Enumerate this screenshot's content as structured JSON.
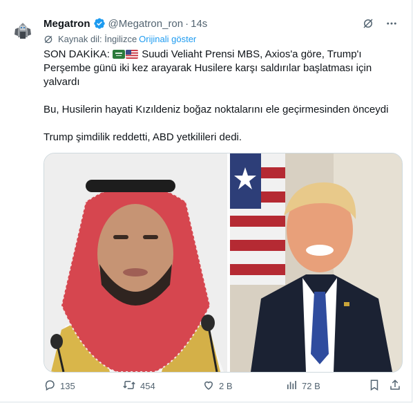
{
  "tweet": {
    "author_name": "Megatron",
    "handle": "@Megatron_ron",
    "separator": "·",
    "time": "14s",
    "source_label": "Kaynak dil: İngilizce",
    "show_original": "Orijinali göster",
    "line1_prefix": "SON DAKİKA:",
    "line1_rest": "Suudi Veliaht Prensi MBS, Axios'a göre, Trump'ı Perşembe günü iki kez arayarak Husilere karşı saldırılar başlatması için yalvardı",
    "paragraph2": "Bu, Husilerin hayati Kızıldeniz boğaz noktalarını ele geçirmesinden önceydi",
    "paragraph3": "Trump şimdilik reddetti, ABD yetkilileri dedi."
  },
  "actions": {
    "replies": "135",
    "reposts": "454",
    "likes": "2 B",
    "views": "72 B"
  },
  "icons": [
    "verified-badge-icon",
    "grok-icon",
    "more-icon",
    "translate-globe-icon",
    "reply-icon",
    "repost-icon",
    "like-icon",
    "views-icon",
    "bookmark-icon",
    "share-icon",
    "saudi-flag-icon",
    "us-flag-icon"
  ],
  "colors": {
    "accent": "#1d9bf0",
    "text": "#0f1419",
    "muted": "#536471"
  }
}
